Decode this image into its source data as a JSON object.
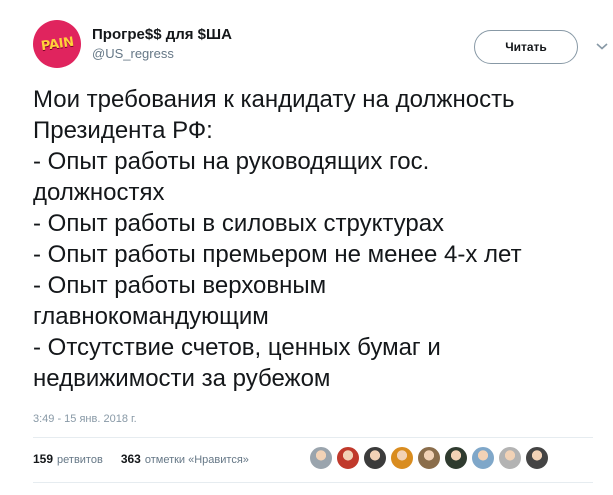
{
  "account": {
    "display_name": "Прогре$$ для $ША",
    "handle": "@US_regress",
    "avatar_text": "PAIN"
  },
  "follow_button": {
    "label": "Читать"
  },
  "tweet": {
    "lines": [
      "Мои требования к кандидату на должность",
      "Президента РФ:",
      "- Опыт работы на руководящих гос.",
      "должностях",
      "- Опыт работы в силовых структурах",
      "- Опыт работы премьером не менее 4-х лет",
      "- Опыт работы верховным",
      "главнокомандующим",
      "- Отсутствие счетов, ценных бумаг и",
      "недвижимости за рубежом"
    ],
    "timestamp": "3:49 - 15 янв. 2018 г."
  },
  "stats": {
    "retweets_count": "159",
    "retweets_label": "ретвитов",
    "likes_count": "363",
    "likes_label": "отметки «Нравится»"
  },
  "likers": [
    {
      "icon": "default-avatar",
      "color": "#9aa4ad"
    },
    {
      "icon": "red-avatar",
      "color": "#c0392b"
    },
    {
      "icon": "dark-avatar",
      "color": "#3b3b3b"
    },
    {
      "icon": "cat-avatar",
      "color": "#d98c1f"
    },
    {
      "icon": "person-avatar",
      "color": "#8a6d4b"
    },
    {
      "icon": "dark-avatar",
      "color": "#2f3b2f"
    },
    {
      "icon": "blue-avatar",
      "color": "#7fa7c9"
    },
    {
      "icon": "grey-avatar",
      "color": "#b3b3b3"
    },
    {
      "icon": "dark-avatar",
      "color": "#444444"
    }
  ],
  "colors": {
    "text": "#14171a",
    "secondary": "#657786",
    "avatar_bg": "#e0245e",
    "avatar_text": "#ffd13b"
  }
}
